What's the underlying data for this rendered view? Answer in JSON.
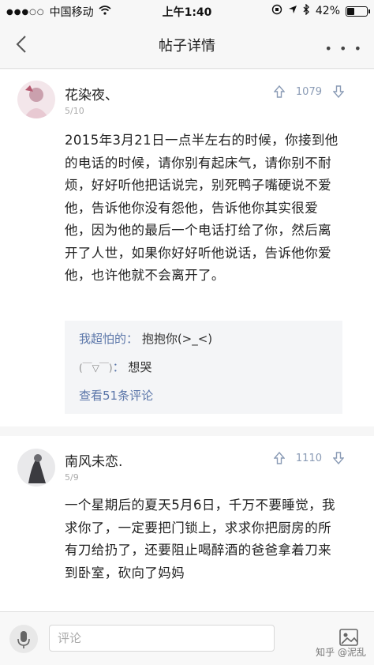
{
  "status_bar": {
    "carrier": "中国移动",
    "time": "上午1:40",
    "battery_percent": "42%",
    "battery_level": 0.42
  },
  "nav": {
    "title": "帖子详情"
  },
  "posts": [
    {
      "author": "花染夜、",
      "date": "5/10",
      "votes": "1079",
      "body": "2015年3月21日一点半左右的时候，你接到他的电话的时候，请你别有起床气，请你别不耐烦，好好听他把话说完，别死鸭子嘴硬说不爱他，告诉他你没有怨他，告诉他你其实很爱他，因为他的最后一个电话打给了你，然后离开了人世，如果你好好听他说话，告诉他你爱他，也许他就不会离开了。",
      "comments": [
        {
          "user": "我超怕的",
          "text": "抱抱你(>_<)"
        },
        {
          "user": "(￣▽￣)",
          "text": "想哭"
        }
      ],
      "view_comments": "查看51条评论"
    },
    {
      "author": "南风未恋.",
      "date": "5/9",
      "votes": "1110",
      "body": "一个星期后的夏天5月6日，千万不要睡觉，我求你了，一定要把门锁上，求求你把厨房的所有刀给扔了，还要阻止喝醉酒的爸爸拿着刀来到卧室，砍向了妈妈"
    }
  ],
  "bottom_bar": {
    "comment_placeholder": "评论",
    "watermark": "知乎 @泥乱"
  },
  "colors": {
    "link_blue": "#5b76a9",
    "vote_gray": "#8a9bb5"
  }
}
